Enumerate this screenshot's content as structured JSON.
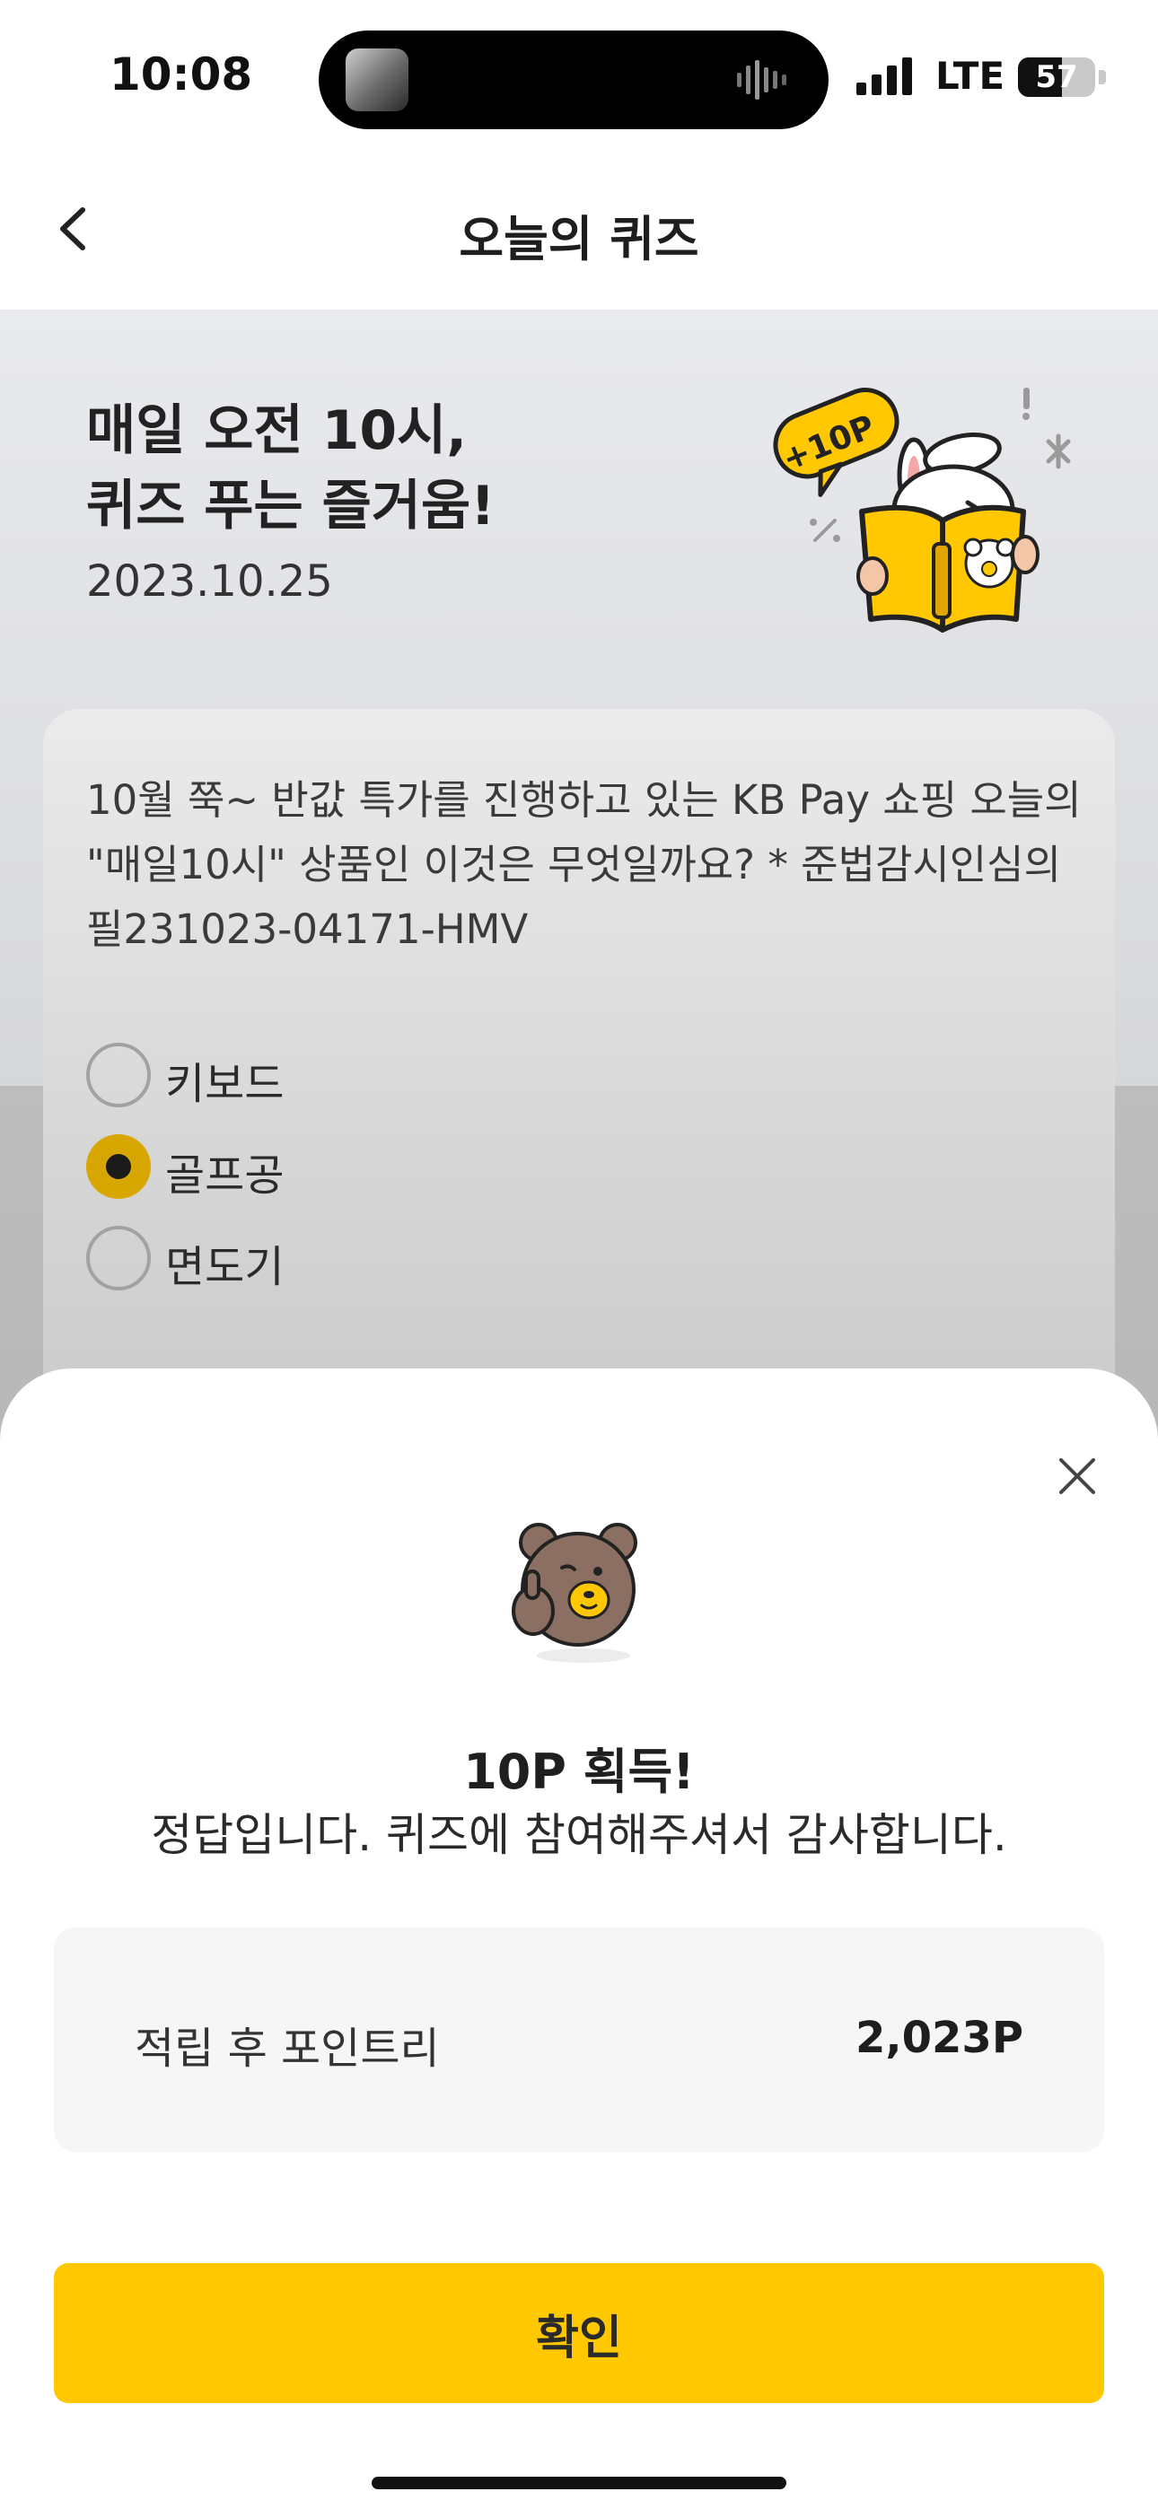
{
  "status_bar": {
    "time": "10:08",
    "network": "LTE",
    "battery_percent": "57",
    "battery_level": 0.57
  },
  "nav": {
    "title": "오늘의 퀴즈",
    "back_icon": "chevron-left-icon"
  },
  "hero": {
    "title": "매일 오전 10시,\n퀴즈 푸는 즐거움!",
    "date": "2023.10.25",
    "badge": "+10P"
  },
  "quiz": {
    "question": "10월 쭉~ 반값 특가를 진행하고 있는 KB Pay 쇼핑 오늘의 \"매일10시\" 상품인 이것은 무엇일까요? * 준법감시인심의필231023-04171-HMV",
    "options": [
      {
        "label": "키보드",
        "selected": false
      },
      {
        "label": "골프공",
        "selected": true
      },
      {
        "label": "면도기",
        "selected": false
      }
    ]
  },
  "result_sheet": {
    "title": "10P 획득!",
    "message": "정답입니다. 퀴즈에 참여해주셔서 감사합니다.",
    "points_label": "적립 후 포인트리",
    "points_value": "2,023P",
    "confirm_label": "확인",
    "close_icon": "close-icon"
  },
  "colors": {
    "accent_yellow": "#FFC800",
    "selected_radio": "#D8A600"
  }
}
